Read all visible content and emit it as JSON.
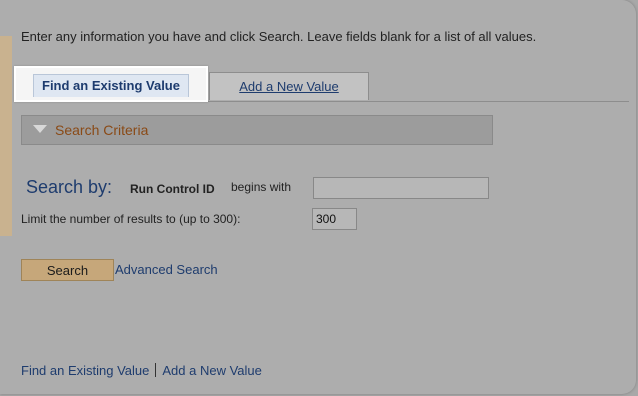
{
  "instructions": "Enter any information you have and click Search. Leave fields blank for a list of all values.",
  "tabs": [
    {
      "label": "Find an Existing Value",
      "active": true
    },
    {
      "label": "Add a New Value",
      "active": false
    }
  ],
  "search_criteria": {
    "label": "Search Criteria"
  },
  "search": {
    "search_by_label": "Search by:",
    "field_label": "Run Control ID",
    "operator": "begins with",
    "field_value": "",
    "limit_label": "Limit the number of results to (up to 300):",
    "limit_value": "300",
    "button_label": "Search",
    "advanced_link": "Advanced Search"
  },
  "footer": {
    "link1": "Find an Existing Value",
    "link2": "Add a New Value"
  },
  "colors": {
    "link": "#1e3c6e",
    "criteria_text": "#8a4a16",
    "button": "#c6a77a",
    "background": "#adadad"
  }
}
